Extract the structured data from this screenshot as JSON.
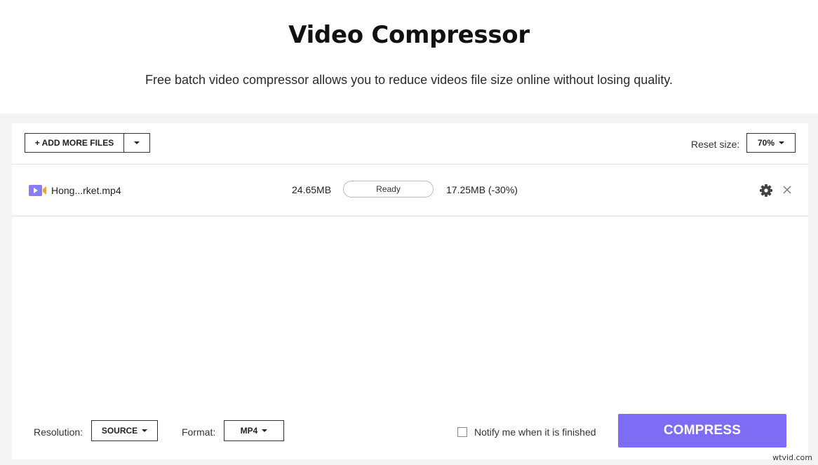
{
  "header": {
    "title": "Video Compressor",
    "subtitle": "Free batch video compressor allows you to reduce videos file size online without losing quality."
  },
  "toolbar": {
    "add_files_label": "+ ADD MORE FILES",
    "reset_size_label": "Reset size:",
    "reset_size_value": "70%"
  },
  "files": [
    {
      "name": "Hong...rket.mp4",
      "original_size": "24.65MB",
      "status": "Ready",
      "compressed_size": "17.25MB (-30%)",
      "icon": "video-file-icon"
    }
  ],
  "footer": {
    "resolution_label": "Resolution:",
    "resolution_value": "SOURCE",
    "format_label": "Format:",
    "format_value": "MP4",
    "notify_label": "Notify me when it is finished",
    "notify_checked": false,
    "compress_label": "COMPRESS"
  },
  "watermark": "wtvid.com",
  "colors": {
    "accent": "#7d6cf4",
    "file_icon_purple": "#8b7cf6",
    "file_icon_orange": "#f5a623",
    "workspace_bg": "#f3f3f5"
  }
}
